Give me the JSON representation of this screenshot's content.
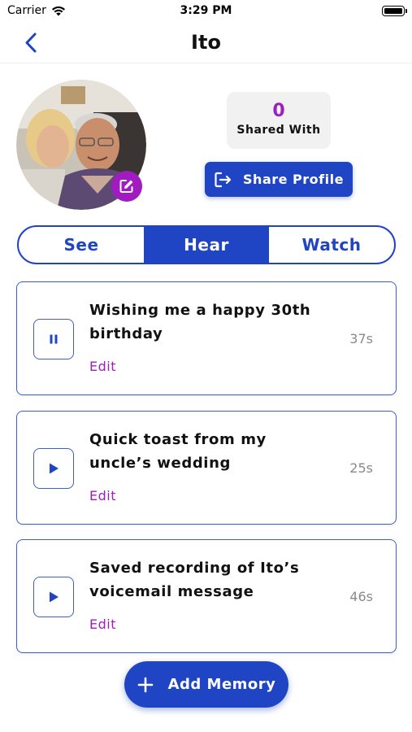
{
  "status_bar": {
    "carrier": "Carrier",
    "time": "3:29 PM"
  },
  "nav": {
    "title": "Ito",
    "back_icon": "chevron-left-icon"
  },
  "profile": {
    "shared_count": "0",
    "shared_label": "Shared With",
    "share_button_label": "Share Profile"
  },
  "segments": [
    {
      "label": "See",
      "active": false
    },
    {
      "label": "Hear",
      "active": true
    },
    {
      "label": "Watch",
      "active": false
    }
  ],
  "memories": [
    {
      "title": "Wishing me a happy 30th birthday",
      "duration": "37s",
      "edit_label": "Edit",
      "state": "playing",
      "icon": "pause-icon"
    },
    {
      "title": "Quick toast from my uncle’s wedding",
      "duration": "25s",
      "edit_label": "Edit",
      "state": "stopped",
      "icon": "play-icon"
    },
    {
      "title": "Saved recording of Ito’s voicemail message",
      "duration": "46s",
      "edit_label": "Edit",
      "state": "stopped",
      "icon": "play-icon"
    }
  ],
  "add_memory_label": "Add Memory",
  "colors": {
    "primary": "#1f45c4",
    "accent": "#a01cc1",
    "muted": "#8a8a8a"
  }
}
